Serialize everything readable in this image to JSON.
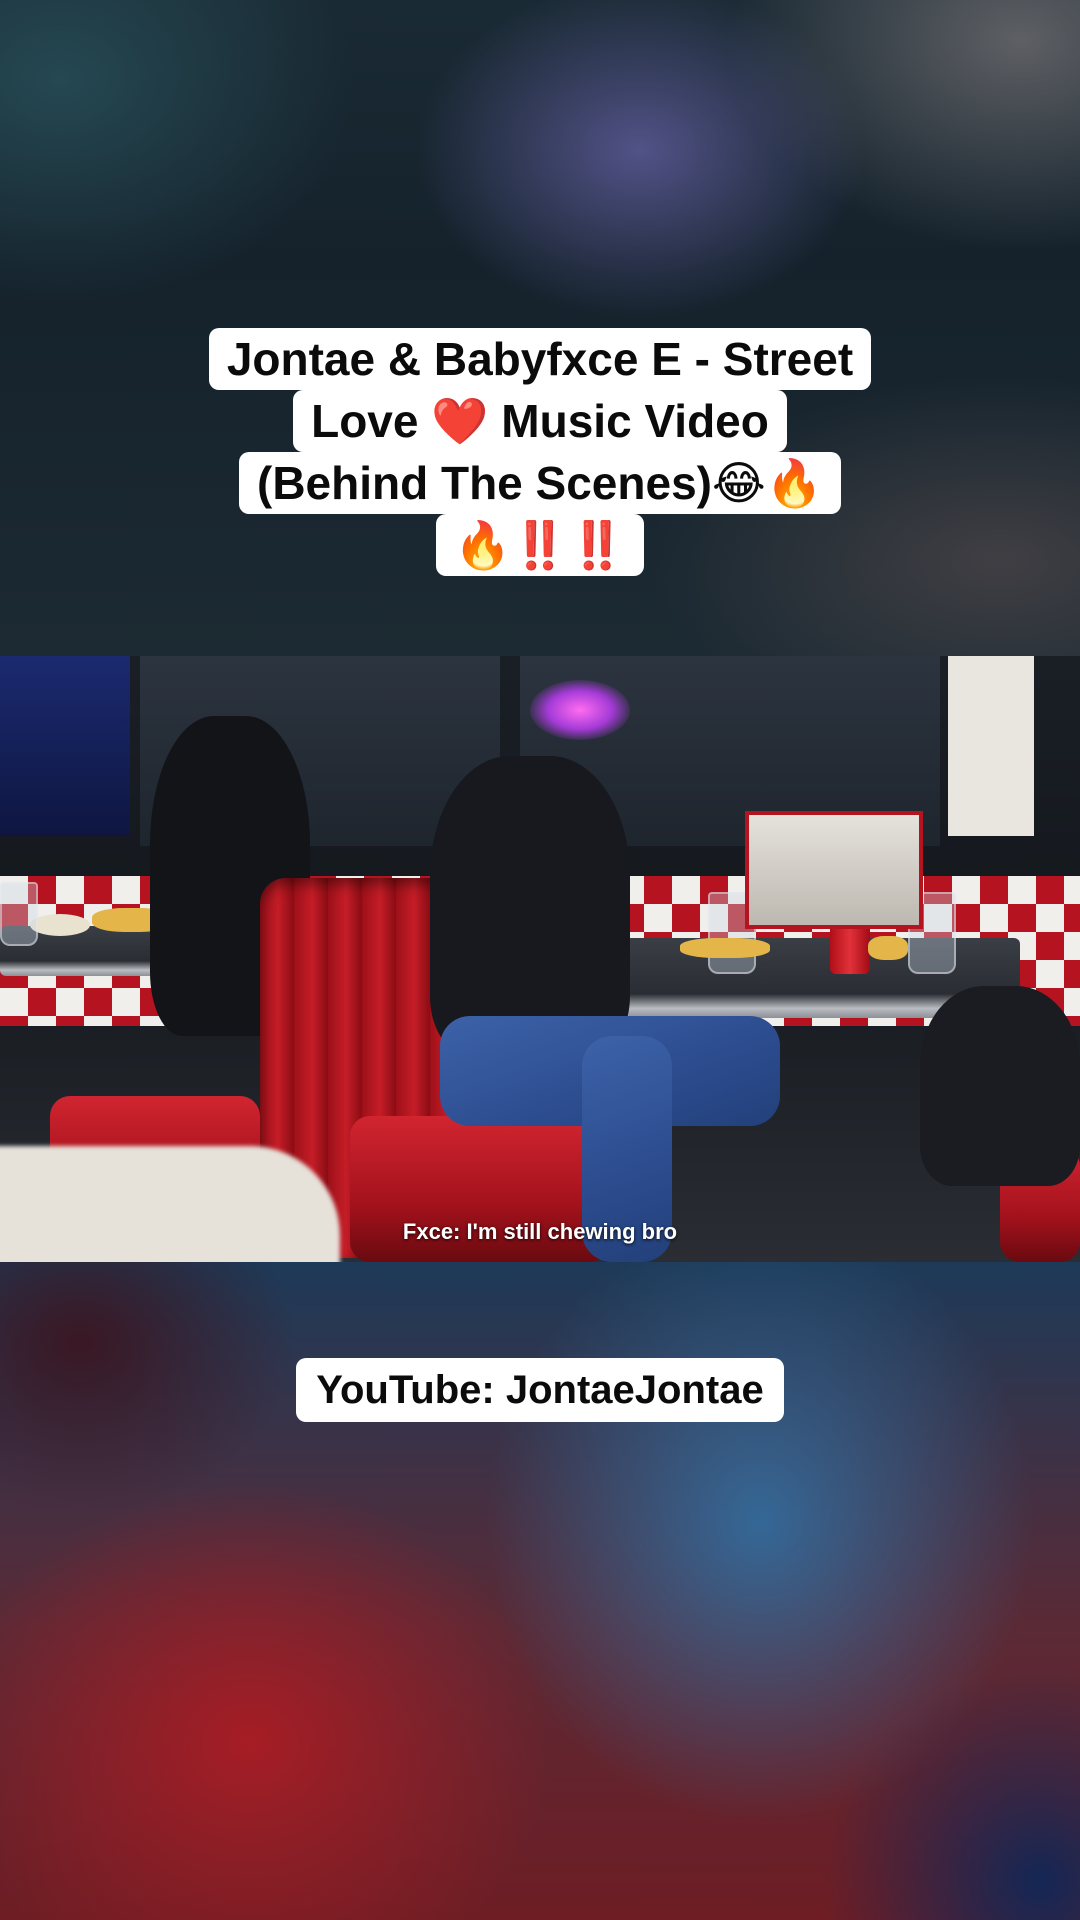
{
  "title_caption": {
    "lines": [
      "Jontae & Babyfxce E - Street",
      "Love ❤️ Music Video",
      "(Behind The Scenes)😂🔥",
      "🔥‼️‼️"
    ]
  },
  "video": {
    "subtitle": "Fxce: I'm still chewing bro"
  },
  "channel_caption": {
    "text": "YouTube: JontaeJontae"
  }
}
